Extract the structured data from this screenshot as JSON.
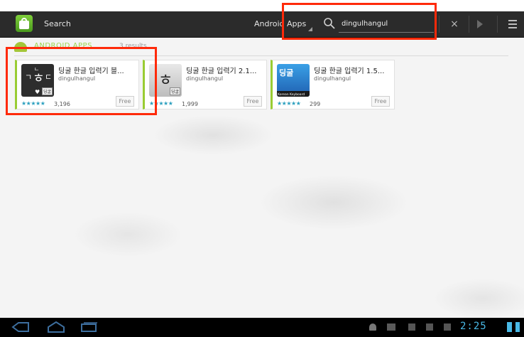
{
  "action_bar": {
    "title": "Search",
    "filter": "Android Apps",
    "search_query": "dingulhangul",
    "clear_symbol": "×"
  },
  "section": {
    "title": "ANDROID APPS",
    "subtitle": "3 results"
  },
  "apps": [
    {
      "title": "딩굴 한글 입력기 블...",
      "developer": "dingulhangul",
      "stars": "★★★★★",
      "rating_count": "3,196",
      "price": "Free",
      "icon_badge": "딩굴"
    },
    {
      "title": "딩굴 한글 입력기 2.1...",
      "developer": "dingulhangul",
      "stars": "★★★★★",
      "rating_count": "1,999",
      "price": "Free",
      "icon_badge": "딩굴"
    },
    {
      "title": "딩굴 한글 입력기 1.5...",
      "developer": "dingulhangul",
      "stars": "★★★★★",
      "rating_count": "299",
      "price": "Free",
      "icon_badge": "딩굴",
      "icon_caption": "Korean Keyboard"
    }
  ],
  "status_bar": {
    "time": "2:25"
  },
  "colors": {
    "accent_green": "#99cc33",
    "highlight_red": "#ff2a0a",
    "clock_blue": "#49b9e6"
  }
}
